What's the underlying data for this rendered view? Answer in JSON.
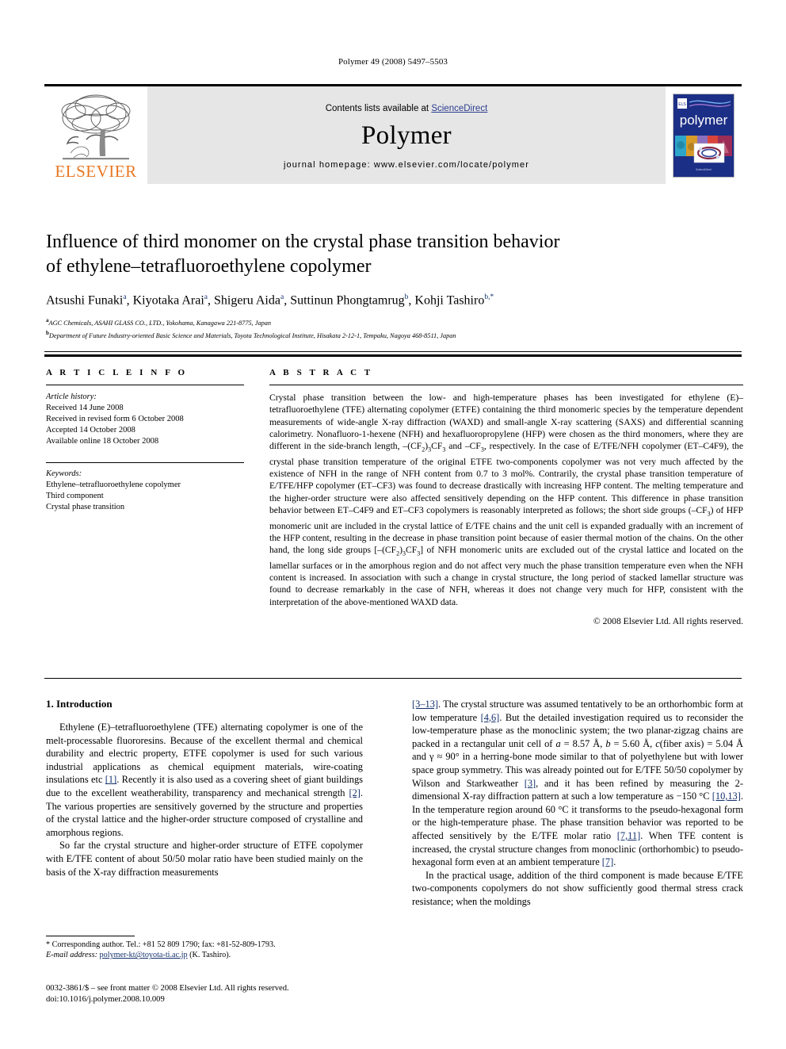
{
  "running_head": "Polymer 49 (2008) 5497–5503",
  "banner": {
    "contents_prefix": "Contents lists available at ",
    "sciencedirect": "ScienceDirect",
    "journal_name": "Polymer",
    "homepage": "journal homepage: www.elsevier.com/locate/polymer",
    "publisher_logo_text": "ELSEVIER",
    "cover_title": "polymer",
    "accent_link_color": "#2b3d8f",
    "elsevier_orange": "#E87722",
    "cover_blue": "#1c2f86"
  },
  "article": {
    "title_line1": "Influence of third monomer on the crystal phase transition behavior",
    "title_line2": "of ethylene–tetrafluoroethylene copolymer",
    "authors": [
      {
        "name": "Atsushi Funaki",
        "sup": "a",
        "sep": ", "
      },
      {
        "name": "Kiyotaka Arai",
        "sup": "a",
        "sep": ", "
      },
      {
        "name": "Shigeru Aida",
        "sup": "a",
        "sep": ", "
      },
      {
        "name": "Suttinun Phongtamrug",
        "sup": "b",
        "sep": ", "
      },
      {
        "name": "Kohji Tashiro",
        "sup": "b,*",
        "sep": ""
      }
    ],
    "affiliations": [
      {
        "sup": "a",
        "text": "AGC Chemicals, ASAHI GLASS CO., LTD., Yokohama, Kanagawa 221-8775, Japan"
      },
      {
        "sup": "b",
        "text": "Department of Future Industry-oriented Basic Science and Materials, Toyota Technological Institute, Hisakata 2-12-1, Tempaku, Nagoya 468-8511, Japan"
      }
    ]
  },
  "article_info": {
    "heading": "A R T I C L E  I N F O",
    "history_label": "Article history:",
    "history": [
      "Received 14 June 2008",
      "Received in revised form 6 October 2008",
      "Accepted 14 October 2008",
      "Available online 18 October 2008"
    ],
    "keywords_label": "Keywords:",
    "keywords": [
      "Ethylene–tetrafluoroethylene copolymer",
      "Third component",
      "Crystal phase transition"
    ]
  },
  "abstract": {
    "heading": "A B S T R A C T",
    "part1": "Crystal phase transition between the low- and high-temperature phases has been investigated for ethylene (E)–tetrafluoroethylene (TFE) alternating copolymer (ETFE) containing the third monomeric species by the temperature dependent measurements of wide-angle X-ray diffraction (WAXD) and small-angle X-ray scattering (SAXS) and differential scanning calorimetry. Nonafluoro-1-hexene (NFH) and hexafluoropropylene (HFP) were chosen as the third monomers, where they are different in the side-branch length, –(CF",
    "sub1": "2",
    "part2": ")",
    "sub2": "3",
    "part3": "CF",
    "sub3": "3",
    "part4": " and –CF",
    "sub4": "3",
    "part5": ", respectively. In the case of E/TFE/NFH copolymer (ET–C4F9), the crystal phase transition temperature of the original ETFE two-components copolymer was not very much affected by the existence of NFH in the range of NFH content from 0.7 to 3 mol%. Contrarily, the crystal phase transition temperature of E/TFE/HFP copolymer (ET–CF3) was found to decrease drastically with increasing HFP content. The melting temperature and the higher-order structure were also affected sensitively depending on the HFP content. This difference in phase transition behavior between ET–C4F9 and ET–CF3 copolymers is reasonably interpreted as follows; the short side groups (–CF",
    "sub5": "3",
    "part6": ") of HFP monomeric unit are included in the crystal lattice of E/TFE chains and the unit cell is expanded gradually with an increment of the HFP content, resulting in the decrease in phase transition point because of easier thermal motion of the chains. On the other hand, the long side groups [–(CF",
    "sub6": "2",
    "part7": ")",
    "sub7": "3",
    "part8": "CF",
    "sub8": "3",
    "part9": "] of NFH monomeric units are excluded out of the crystal lattice and located on the lamellar surfaces or in the amorphous region and do not affect very much the phase transition temperature even when the NFH content is increased. In association with such a change in crystal structure, the long period of stacked lamellar structure was found to decrease remarkably in the case of NFH, whereas it does not change very much for HFP, consistent with the interpretation of the above-mentioned WAXD data.",
    "copyright": "© 2008 Elsevier Ltd. All rights reserved."
  },
  "introduction": {
    "heading": "1. Introduction",
    "left_p1_a": "Ethylene (E)–tetrafluoroethylene (TFE) alternating copolymer is one of the melt-processable fluororesins. Because of the excellent thermal and chemical durability and electric property, ETFE copolymer is used for such various industrial applications as chemical equipment materials, wire-coating insulations etc ",
    "left_p1_ref1": "[1]",
    "left_p1_b": ". Recently it is also used as a covering sheet of giant buildings due to the excellent weatherability, transparency and mechanical strength ",
    "left_p1_ref2": "[2]",
    "left_p1_c": ". The various properties are sensitively governed by the structure and properties of the crystal lattice and the higher-order structure composed of crystalline and amorphous regions.",
    "left_p2": "So far the crystal structure and higher-order structure of ETFE copolymer with E/TFE content of about 50/50 molar ratio have been studied mainly on the basis of the X-ray diffraction measurements",
    "right_p1_ref1": "[3–13]",
    "right_p1_a": ". The crystal structure was assumed tentatively to be an orthorhombic form at low temperature ",
    "right_p1_ref2": "[4,6]",
    "right_p1_b": ". But the detailed investigation required us to reconsider the low-temperature phase as the monoclinic system; the two planar-zigzag chains are packed in a rectangular unit cell of ",
    "cell_a": "a",
    "cell_a_val": " = 8.57 Å,  ",
    "cell_b": "b",
    "cell_b_val": " = 5.60 Å,  ",
    "cell_c": "c",
    "cell_c_val": "(fiber axis) = 5.04 Å and γ ≈ 90° in a herring-bone mode similar to that of polyethylene but with lower space group symmetry. This was already pointed out for E/TFE 50/50 copolymer by Wilson and Starkweather ",
    "right_p1_ref3": "[3]",
    "right_p1_c": ", and it has been refined by measuring the 2-dimensional X-ray diffraction pattern at such a low temperature as −150 °C ",
    "right_p1_ref4": "[10,13]",
    "right_p1_d": ". In the temperature region around 60 °C it transforms to the pseudo-hexagonal form or the high-temperature phase. The phase transition behavior was reported to be affected sensitively by the E/TFE molar ratio ",
    "right_p1_ref5": "[7,11]",
    "right_p1_e": ". When TFE content is increased, the crystal structure changes from monoclinic (orthorhombic) to pseudo-hexagonal form even at an ambient temperature ",
    "right_p1_ref6": "[7]",
    "right_p1_f": ".",
    "right_p2": "In the practical usage, addition of the third component is made because E/TFE two-components copolymers do not show sufficiently good thermal stress crack resistance; when the moldings"
  },
  "footnote": {
    "corresponding": "* Corresponding author. Tel.: +81 52 809 1790; fax: +81-52-809-1793.",
    "email_label": "E-mail address:",
    "email": "polymer-kt@toyota-ti.ac.jp",
    "email_suffix": " (K. Tashiro).",
    "imprint_line1": "0032-3861/$ – see front matter © 2008 Elsevier Ltd. All rights reserved.",
    "imprint_line2": "doi:10.1016/j.polymer.2008.10.009"
  }
}
